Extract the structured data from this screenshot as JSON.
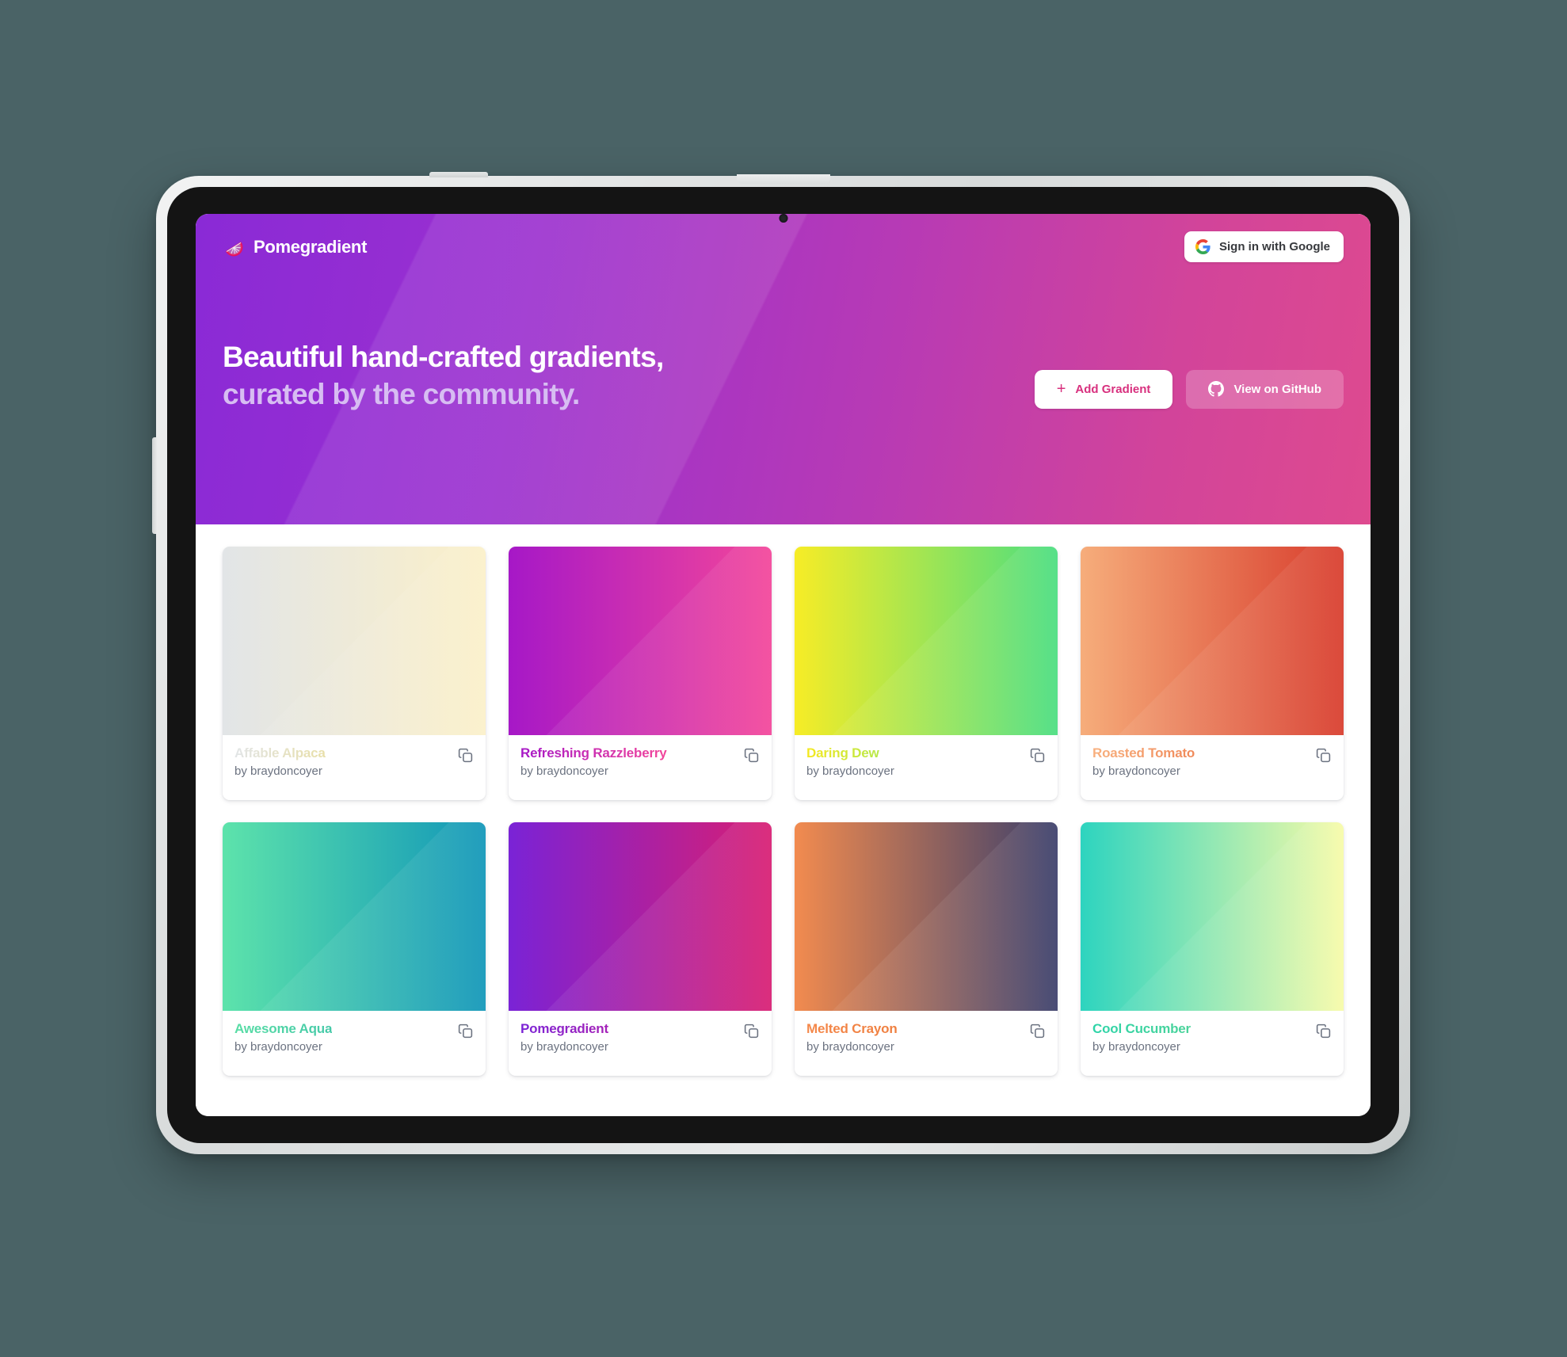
{
  "brand": {
    "name": "Pomegradient",
    "logo_icon": "pomegranate-slice-icon"
  },
  "header": {
    "sign_in_label": "Sign in with Google",
    "google_icon": "google-g-icon"
  },
  "hero": {
    "heading_line1": "Beautiful hand-crafted gradients,",
    "heading_line2": "curated by the community.",
    "heading_line1_color": "#ffffff",
    "heading_line2_color": "#d7bdf2",
    "gradient_from": "#8a2ad6",
    "gradient_to": "#de4a8f",
    "add_label": "Add Gradient",
    "add_icon": "plus-icon",
    "add_text_color": "#d8307e",
    "github_label": "View on GitHub",
    "github_icon": "github-icon"
  },
  "gallery": {
    "author_prefix": "by ",
    "copy_icon": "copy-icon",
    "cards": [
      {
        "title": "Affable Alpaca",
        "author": "by braydoncoyer",
        "from": "#e2e5e7",
        "to": "#fbf0c9",
        "angle": "90deg",
        "title_from": "#e2e5e7",
        "title_to": "#e8dfa8"
      },
      {
        "title": "Refreshing Razzleberry",
        "author": "by braydoncoyer",
        "from": "#a618c7",
        "to": "#f3469a",
        "angle": "90deg",
        "title_from": "#a618c7",
        "title_to": "#f3469a"
      },
      {
        "title": "Daring Dew",
        "author": "by braydoncoyer",
        "from": "#f7ec26",
        "to": "#4ade80",
        "angle": "90deg",
        "title_from": "#f5e821",
        "title_to": "#a8e84f"
      },
      {
        "title": "Roasted Tomato",
        "author": "by braydoncoyer",
        "from": "#f6ad7b",
        "to": "#d83c2c",
        "angle": "90deg",
        "title_from": "#f8b07e",
        "title_to": "#f08a5a"
      },
      {
        "title": "Awesome Aqua",
        "author": "by braydoncoyer",
        "from": "#5de3ab",
        "to": "#1196b8",
        "angle": "90deg",
        "title_from": "#58dda5",
        "title_to": "#45c9a8"
      },
      {
        "title": "Pomegradient",
        "author": "by braydoncoyer",
        "from": "#7a23d6",
        "to": "#d81e73",
        "angle": "90deg",
        "title_from": "#7a23d6",
        "title_to": "#a521b8"
      },
      {
        "title": "Melted Crayon",
        "author": "by braydoncoyer",
        "from": "#f28b4f",
        "to": "#3b3f6b",
        "angle": "90deg",
        "title_from": "#f5884a",
        "title_to": "#ef7f3f"
      },
      {
        "title": "Cool Cucumber",
        "author": "by braydoncoyer",
        "from": "#2dd4bf",
        "to": "#f7fba8",
        "angle": "90deg",
        "title_from": "#2dd4a8",
        "title_to": "#4bd39a"
      }
    ]
  }
}
